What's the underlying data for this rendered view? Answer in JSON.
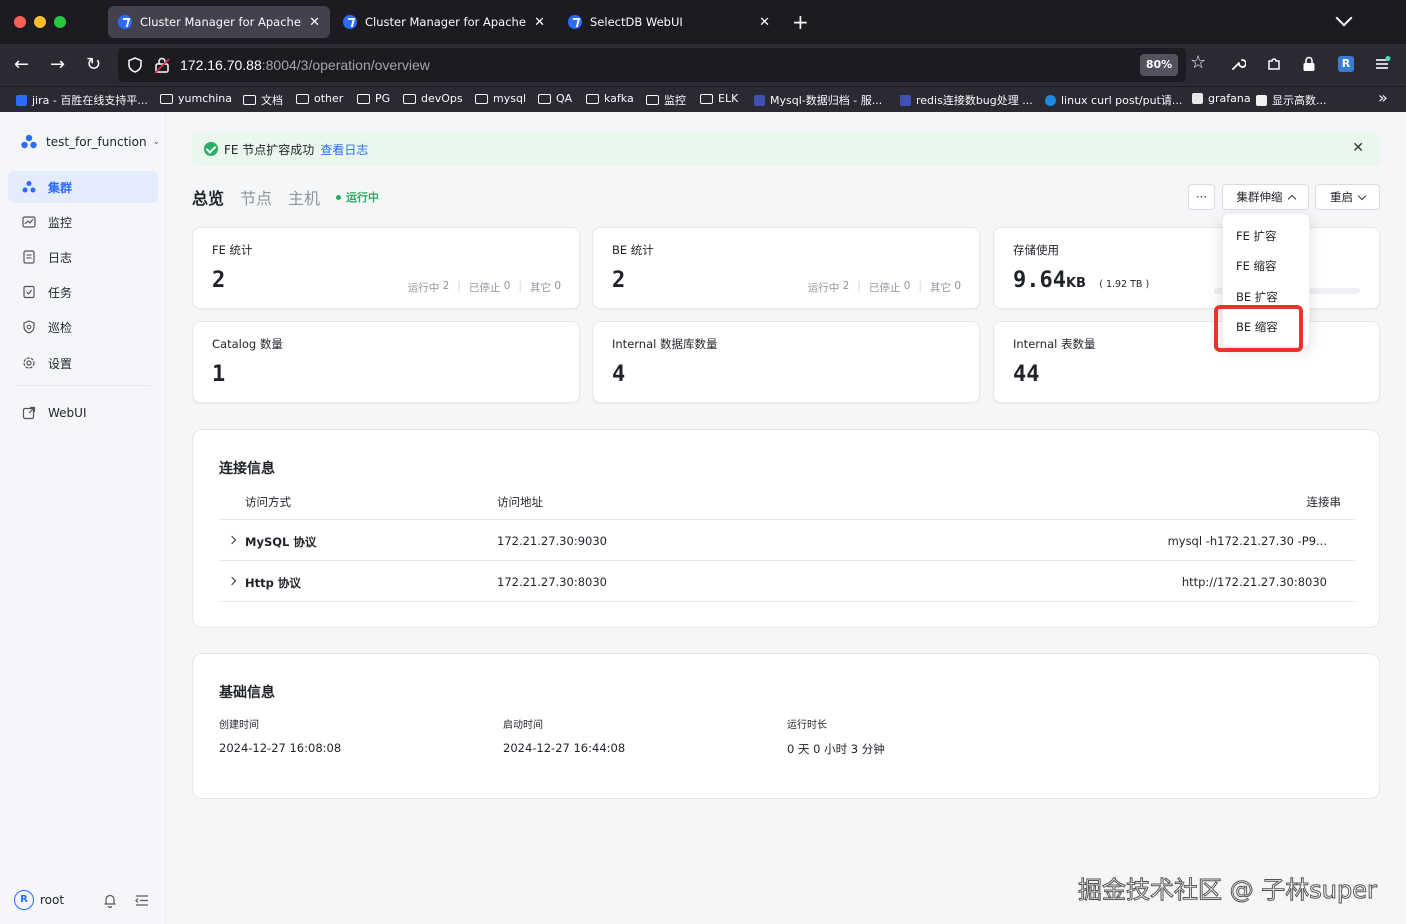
{
  "browser": {
    "tabs": [
      {
        "title": "Cluster Manager for Apache Dor",
        "active": true
      },
      {
        "title": "Cluster Manager for Apache Dor",
        "active": false
      },
      {
        "title": "SelectDB WebUI",
        "active": false
      }
    ],
    "url_host": "172.16.70.88",
    "url_path": ":8004/3/operation/overview",
    "zoom": "80%",
    "bookmarks": [
      {
        "label": "jira - 百胜在线支持平...",
        "type": "site"
      },
      {
        "label": "yumchina",
        "type": "folder"
      },
      {
        "label": "文档",
        "type": "folder"
      },
      {
        "label": "other",
        "type": "folder"
      },
      {
        "label": "PG",
        "type": "folder"
      },
      {
        "label": "devOps",
        "type": "folder"
      },
      {
        "label": "mysql",
        "type": "folder"
      },
      {
        "label": "QA",
        "type": "folder"
      },
      {
        "label": "kafka",
        "type": "folder"
      },
      {
        "label": "监控",
        "type": "folder"
      },
      {
        "label": "ELK",
        "type": "folder"
      },
      {
        "label": "Mysql-数据归档 - 服...",
        "type": "site"
      },
      {
        "label": "redis连接数bug处理 ...",
        "type": "site"
      },
      {
        "label": "linux curl post/put请...",
        "type": "site"
      },
      {
        "label": "grafana",
        "type": "site"
      },
      {
        "label": "显示高数...",
        "type": "site"
      }
    ]
  },
  "sidebar": {
    "cluster_name": "test_for_function",
    "items": [
      {
        "label": "集群",
        "active": true
      },
      {
        "label": "监控",
        "active": false
      },
      {
        "label": "日志",
        "active": false
      },
      {
        "label": "任务",
        "active": false
      },
      {
        "label": "巡检",
        "active": false
      },
      {
        "label": "设置",
        "active": false
      }
    ],
    "webui": "WebUI",
    "user": {
      "initial": "R",
      "name": "root"
    }
  },
  "alert": {
    "message": "FE 节点扩容成功",
    "link": "查看日志"
  },
  "page_tabs": [
    "总览",
    "节点",
    "主机"
  ],
  "status": "运行中",
  "actions": {
    "more": "···",
    "scale": "集群伸缩",
    "restart": "重启"
  },
  "scale_menu": [
    "FE 扩容",
    "FE 缩容",
    "BE 扩容",
    "BE 缩容"
  ],
  "cards": {
    "fe": {
      "label": "FE 统计",
      "value": "2",
      "running_label": "运行中",
      "running": "2",
      "stopped_label": "已停止",
      "stopped": "0",
      "other_label": "其它",
      "other": "0"
    },
    "be": {
      "label": "BE 统计",
      "value": "2",
      "running_label": "运行中",
      "running": "2",
      "stopped_label": "已停止",
      "stopped": "0",
      "other_label": "其它",
      "other": "0"
    },
    "storage": {
      "label": "存储使用",
      "value": "9.64",
      "unit": "KB",
      "total": "( 1.92 TB )"
    },
    "catalog": {
      "label": "Catalog 数量",
      "value": "1"
    },
    "databases": {
      "label": "Internal 数据库数量",
      "value": "4"
    },
    "tables": {
      "label": "Internal 表数量",
      "value": "44"
    }
  },
  "connection": {
    "title": "连接信息",
    "columns": [
      "访问方式",
      "访问地址",
      "连接串"
    ],
    "rows": [
      {
        "method": "MySQL 协议",
        "address": "172.21.27.30:9030",
        "conn": "mysql -h172.21.27.30 -P9..."
      },
      {
        "method": "Http 协议",
        "address": "172.21.27.30:8030",
        "conn": "http://172.21.27.30:8030"
      }
    ]
  },
  "basic": {
    "title": "基础信息",
    "created_label": "创建时间",
    "created": "2024-12-27 16:08:08",
    "started_label": "启动时间",
    "started": "2024-12-27 16:44:08",
    "uptime_label": "运行时长",
    "uptime": "0 天 0 小时 3 分钟"
  },
  "watermark": "掘金技术社区 @ 子林super",
  "colors": {
    "accent": "#2c6bff",
    "success": "#27ae60",
    "highlight": "#e8322b"
  }
}
